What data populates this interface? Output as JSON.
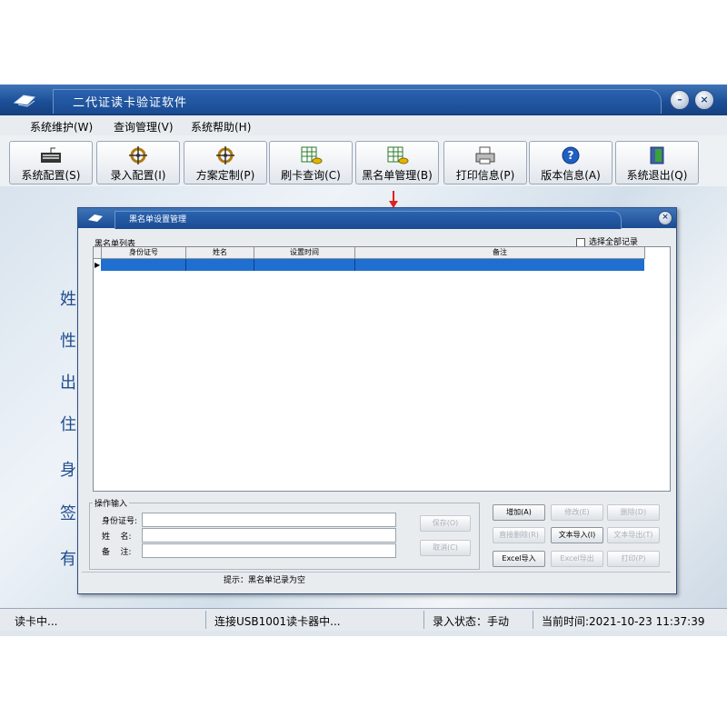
{
  "window": {
    "title": "二代证读卡验证软件"
  },
  "menu": [
    "系统维护(W)",
    "查询管理(V)",
    "系统帮助(H)"
  ],
  "toolbar": [
    {
      "label": "系统配置(S)",
      "icon": "keyboard-icon"
    },
    {
      "label": "录入配置(I)",
      "icon": "ship-wheel-icon"
    },
    {
      "label": "方案定制(P)",
      "icon": "ship-wheel-icon"
    },
    {
      "label": "刷卡查询(C)",
      "icon": "table-coins-icon"
    },
    {
      "label": "黑名单管理(B)",
      "icon": "table-coins-icon"
    },
    {
      "label": "打印信息(P)",
      "icon": "printer-icon"
    },
    {
      "label": "版本信息(A)",
      "icon": "help-icon"
    },
    {
      "label": "系统退出(Q)",
      "icon": "exit-door-icon"
    }
  ],
  "side_chars": [
    "姓",
    "性",
    "出",
    "住",
    "身",
    "签",
    "有"
  ],
  "status": {
    "reading": "读卡中...",
    "connection": "连接USB1001读卡器中...",
    "input_mode": "录入状态：手动",
    "time": "当前时间:2021-10-23 11:37:39"
  },
  "dialog": {
    "title": "黑名单设置管理",
    "list_label": "黑名单列表",
    "select_all": "选择全部记录",
    "columns": [
      "身份证号",
      "姓名",
      "设置时间",
      "备注"
    ],
    "ops_label": "操作输入",
    "fields": [
      {
        "label": "身份证号:",
        "value": ""
      },
      {
        "label": "姓    名:",
        "value": ""
      },
      {
        "label": "备    注:",
        "value": ""
      }
    ],
    "left_buttons": [
      "保存(O)",
      "取消(C)"
    ],
    "buttons": [
      {
        "label": "增加(A)",
        "enabled": true
      },
      {
        "label": "修改(E)",
        "enabled": false
      },
      {
        "label": "删除(D)",
        "enabled": false
      },
      {
        "label": "直接删除(R)",
        "enabled": false
      },
      {
        "label": "文本导入(I)",
        "enabled": true
      },
      {
        "label": "文本导出(T)",
        "enabled": false
      },
      {
        "label": "Excel导入",
        "enabled": true
      },
      {
        "label": "Excel导出",
        "enabled": false
      },
      {
        "label": "打印(P)",
        "enabled": false
      }
    ],
    "hint": "提示：黑名单记录为空"
  },
  "colors": {
    "title_blue": "#1c4f98",
    "selection_blue": "#1f6fd0",
    "arrow_red": "#e02020"
  }
}
